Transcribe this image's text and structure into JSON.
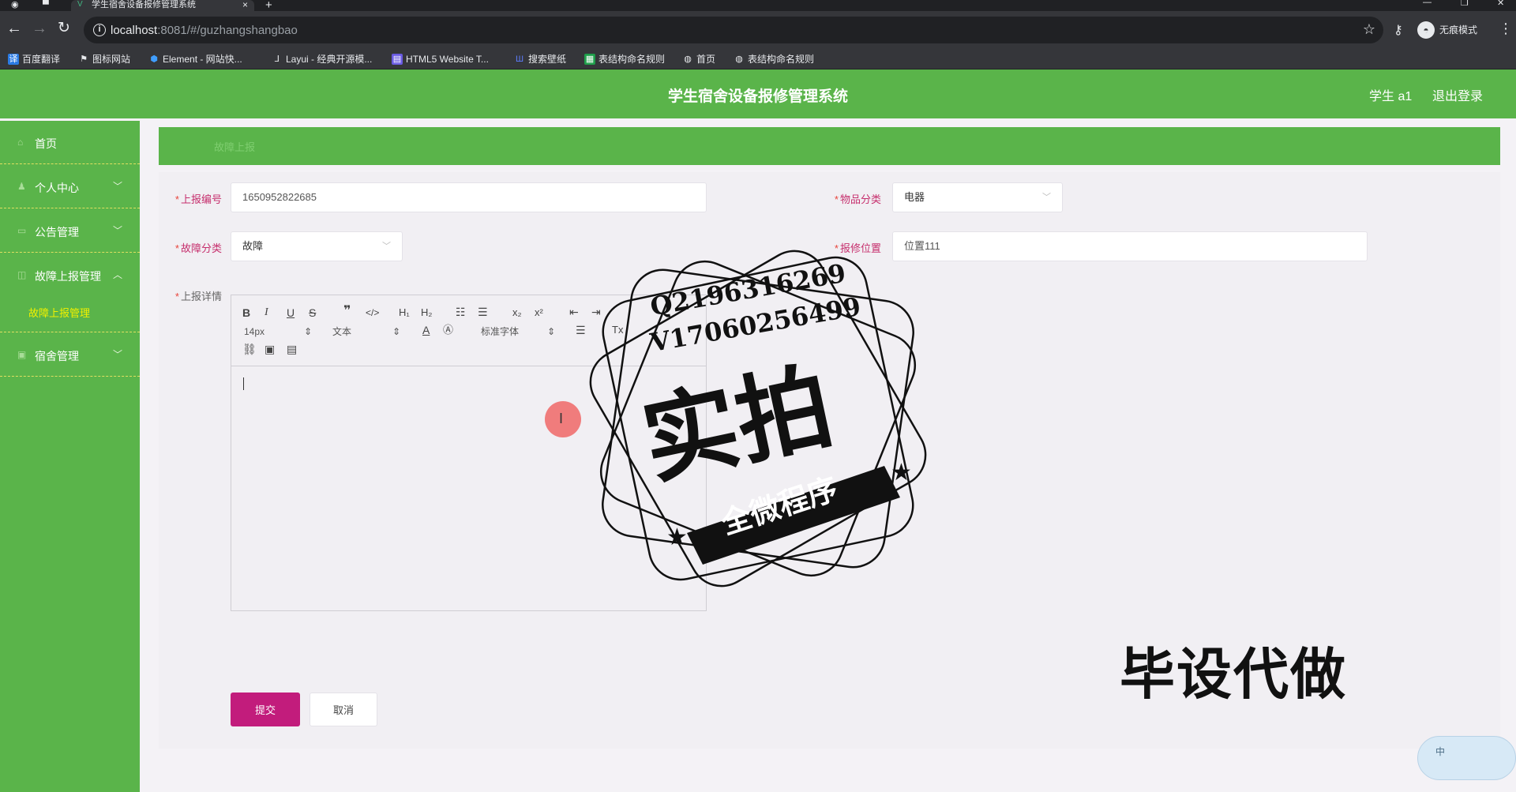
{
  "browser": {
    "tab_title": "学生宿舍设备报修管理系统",
    "tab_close": "×",
    "new_tab": "+",
    "url_host": "localhost",
    "url_rest": ":8081/#/guzhangshangbao",
    "profile_label": "无痕模式",
    "bookmarks": [
      {
        "label": "百度翻译",
        "icon": "baidu-translate-icon",
        "color": "#2b7be4"
      },
      {
        "label": "图标网站",
        "icon": "flag-icon",
        "color": "#e8eaed"
      },
      {
        "label": "Element - 网站快...",
        "icon": "element-icon",
        "color": "#409eff"
      },
      {
        "label": "Layui - 经典开源模...",
        "icon": "layui-icon",
        "color": "#e8eaed"
      },
      {
        "label": "HTML5 Website T...",
        "icon": "html5-icon",
        "color": "#6a5be2"
      },
      {
        "label": "搜索壁纸",
        "icon": "wallpaper-icon",
        "color": "#5c7cfa"
      },
      {
        "label": "表结构命名规则",
        "icon": "sheet-icon",
        "color": "#1e9e4a"
      },
      {
        "label": "首页",
        "icon": "globe-icon",
        "color": "#e8eaed"
      },
      {
        "label": "表结构命名规则",
        "icon": "globe-icon",
        "color": "#e8eaed"
      }
    ]
  },
  "header": {
    "title": "学生宿舍设备报修管理系统",
    "user": "学生 a1",
    "logout": "退出登录"
  },
  "sidebar": {
    "items": [
      {
        "label": "首页",
        "icon": "home-icon",
        "expandable": false
      },
      {
        "label": "个人中心",
        "icon": "user-icon",
        "expandable": true,
        "expanded": false
      },
      {
        "label": "公告管理",
        "icon": "notice-icon",
        "expandable": true,
        "expanded": false
      },
      {
        "label": "故障上报管理",
        "icon": "fault-icon",
        "expandable": true,
        "expanded": true
      },
      {
        "label": "宿舍管理",
        "icon": "dorm-icon",
        "expandable": true,
        "expanded": false
      }
    ],
    "subitem": "故障上报管理"
  },
  "breadcrumb": "故障上报",
  "form": {
    "report_no_label": "上报编号",
    "report_no_value": "1650952822685",
    "item_category_label": "物品分类",
    "item_category_value": "电器",
    "fault_category_label": "故障分类",
    "fault_category_value": "故障",
    "location_label": "报修位置",
    "location_value": "位置111",
    "details_label": "上报详情",
    "submit": "提交",
    "cancel": "取消"
  },
  "editor": {
    "font_size": "14px",
    "block_type": "文本",
    "font_family": "标准字体"
  },
  "watermark": {
    "contact_q": "Q2196316269",
    "contact_v": "V17060256499",
    "big": "实拍",
    "ribbon": "全微程序",
    "bottom": "毕设代做"
  },
  "ime": "中",
  "colors": {
    "brand_green": "#5ab44a",
    "submit_magenta": "#c21c7c",
    "label_pink": "#c62f6d"
  }
}
